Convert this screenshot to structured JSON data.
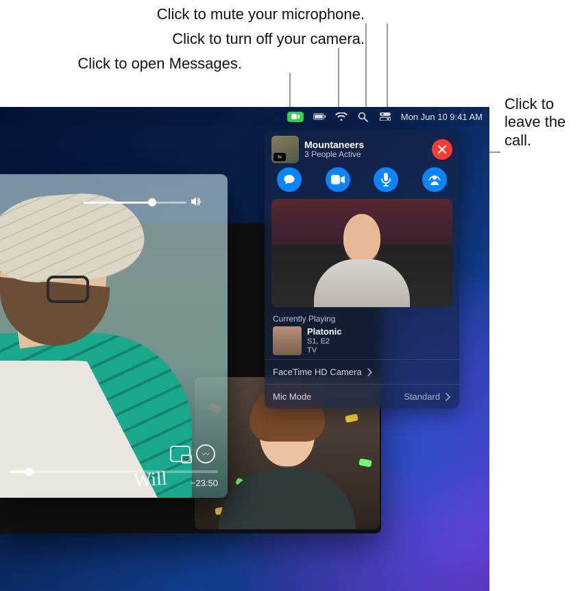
{
  "callouts": {
    "mute": "Click to mute your microphone.",
    "camera": "Click to turn off your camera.",
    "messages": "Click to open Messages.",
    "leave": "Click to leave the call."
  },
  "menubar": {
    "datetime": "Mon Jun 10  9:41 AM"
  },
  "panel": {
    "title": "Mountaneers",
    "subtitle": "3 People Active",
    "now_playing_label": "Currently Playing",
    "media": {
      "title": "Platonic",
      "subtitle": "S1, E2",
      "source": "TV"
    },
    "camera_row_label": "FaceTime HD Camera",
    "mic_row_label": "Mic Mode",
    "mic_row_value": "Standard",
    "thumb_badge": "tv"
  },
  "player": {
    "signature": "Will",
    "time_remaining": "−23:50"
  }
}
